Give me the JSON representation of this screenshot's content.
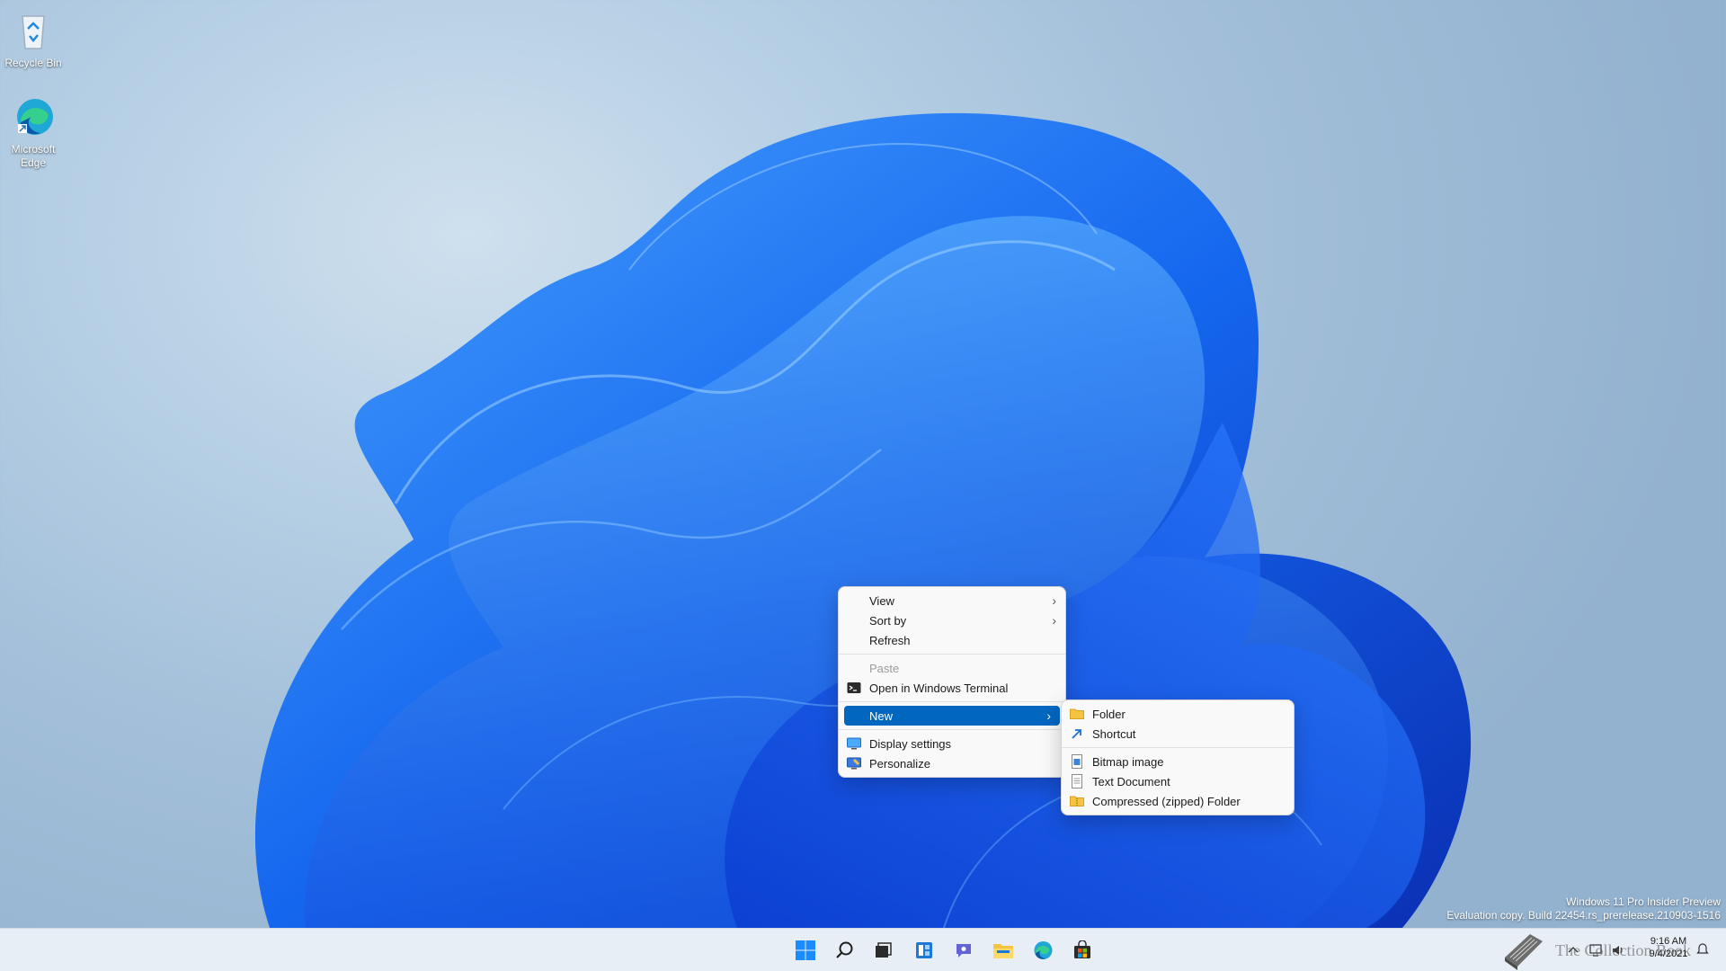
{
  "desktop": {
    "icons": [
      {
        "label": "Recycle Bin",
        "icon": "recycle-bin-icon"
      },
      {
        "label": "Microsoft Edge",
        "icon": "edge-icon"
      }
    ]
  },
  "context_menu": {
    "items": [
      {
        "label": "View",
        "has_submenu": true
      },
      {
        "label": "Sort by",
        "has_submenu": true
      },
      {
        "label": "Refresh"
      },
      {
        "label": "Paste",
        "disabled": true
      },
      {
        "label": "Open in Windows Terminal",
        "icon": "terminal-icon"
      },
      {
        "label": "New",
        "has_submenu": true,
        "highlighted": true
      },
      {
        "label": "Display settings",
        "icon": "display-icon"
      },
      {
        "label": "Personalize",
        "icon": "personalize-icon"
      }
    ]
  },
  "new_submenu": {
    "items": [
      {
        "label": "Folder",
        "icon": "folder-icon"
      },
      {
        "label": "Shortcut",
        "icon": "shortcut-icon"
      },
      {
        "label": "Bitmap image",
        "icon": "bitmap-icon"
      },
      {
        "label": "Text Document",
        "icon": "text-document-icon"
      },
      {
        "label": "Compressed (zipped) Folder",
        "icon": "zip-folder-icon"
      }
    ]
  },
  "watermark": {
    "line1": "Windows 11 Pro Insider Preview",
    "line2": "Evaluation copy. Build 22454.rs_prerelease.210903-1516"
  },
  "taskbar": {
    "apps": [
      "start-icon",
      "search-icon",
      "task-view-icon",
      "widgets-icon",
      "chat-icon",
      "file-explorer-icon",
      "edge-icon",
      "store-icon"
    ],
    "clock": {
      "time": "9:16 AM",
      "date": "9/4/2021"
    }
  },
  "overlay": {
    "text": "The Collection Book"
  },
  "colors": {
    "accent": "#0067c0",
    "bloom": "#1a6cf0",
    "taskbar": "#e7eef5"
  }
}
